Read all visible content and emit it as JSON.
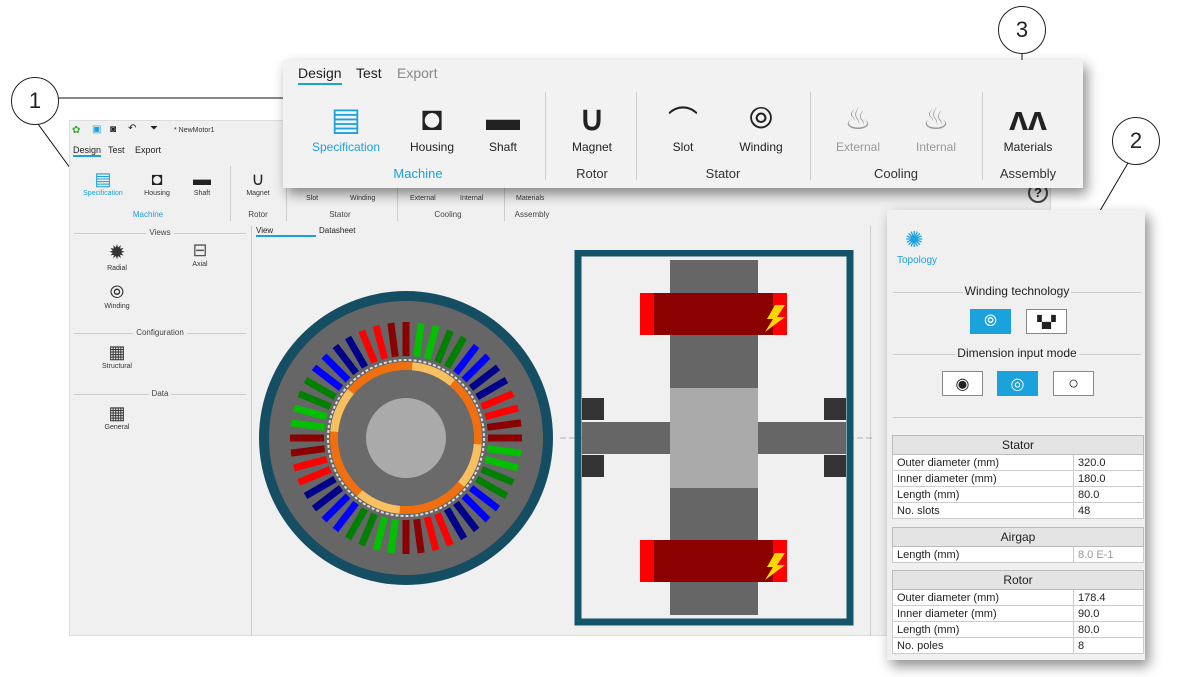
{
  "app": {
    "title": "* NewMotor1",
    "tabs": [
      "Design",
      "Test",
      "Export"
    ],
    "ribbon": {
      "items": [
        {
          "label": "Specification",
          "icon": "specification-icon"
        },
        {
          "label": "Housing",
          "icon": "housing-icon"
        },
        {
          "label": "Shaft",
          "icon": "shaft-icon"
        },
        {
          "label": "Magnet",
          "icon": "magnet-icon"
        },
        {
          "label": "Slot",
          "icon": "slot-icon"
        },
        {
          "label": "Winding",
          "icon": "winding-icon"
        },
        {
          "label": "External",
          "icon": "external-cooling-icon"
        },
        {
          "label": "Internal",
          "icon": "internal-cooling-icon"
        },
        {
          "label": "Materials",
          "icon": "materials-icon"
        }
      ],
      "groups": [
        "Machine",
        "Rotor",
        "Stator",
        "Cooling",
        "Assembly"
      ]
    },
    "left": {
      "views_title": "Views",
      "views": [
        "Radial",
        "Axial",
        "Winding"
      ],
      "config_title": "Configuration",
      "config": [
        "Structural"
      ],
      "data_title": "Data",
      "data": [
        "General"
      ]
    },
    "view_tabs": [
      "View",
      "Datasheet"
    ],
    "help": "?"
  },
  "callouts": [
    "1",
    "2",
    "3"
  ],
  "panel": {
    "topology": "Topology",
    "winding_title": "Winding technology",
    "dim_title": "Dimension input mode",
    "stator": {
      "title": "Stator",
      "rows": [
        [
          "Outer diameter (mm)",
          "320.0"
        ],
        [
          "Inner diameter (mm)",
          "180.0"
        ],
        [
          "Length (mm)",
          "80.0"
        ],
        [
          "No. slots",
          "48"
        ]
      ]
    },
    "airgap": {
      "title": "Airgap",
      "rows": [
        [
          "Length (mm)",
          "8.0 E-1"
        ]
      ]
    },
    "rotor": {
      "title": "Rotor",
      "rows": [
        [
          "Outer diameter (mm)",
          "178.4"
        ],
        [
          "Inner diameter (mm)",
          "90.0"
        ],
        [
          "Length (mm)",
          "80.0"
        ],
        [
          "No. poles",
          "8"
        ]
      ]
    }
  },
  "colors": {
    "accent": "#1ba1dc",
    "frame": "#15536b"
  }
}
